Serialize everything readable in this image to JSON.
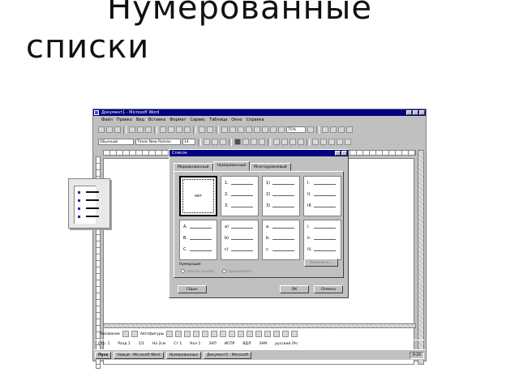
{
  "slide": {
    "title_line1": "Нумерованные",
    "title_line2": "списки"
  },
  "window": {
    "title": "Документ1 - Microsoft Word",
    "menu": [
      "Файл",
      "Правка",
      "Вид",
      "Вставка",
      "Формат",
      "Сервис",
      "Таблица",
      "Окно",
      "Справка"
    ],
    "style_combo": "Обычный",
    "font_combo": "Times New Roman",
    "size_combo": "14",
    "zoom_combo": "75%",
    "draw_label": "Рисование",
    "autoshapes_label": "Автофигуры",
    "status": [
      "Стр. 1",
      "Разд 1",
      "1/1",
      "На 2см",
      "Ст 1",
      "Кол 1",
      "ЗАП",
      "ИСПР",
      "ВДЛ",
      "ЗАМ",
      "русский (Ро"
    ],
    "taskbar": {
      "start": "Пуск",
      "items": [
        "Новый - Microsoft Word",
        "Нумерованные",
        "Документ1 - Microsoft"
      ],
      "clock": "9:26"
    }
  },
  "dialog": {
    "title": "Список",
    "tabs": [
      "Маркированный",
      "Нумерованный",
      "Многоуровневый"
    ],
    "active_tab": 1,
    "none_label": "нет",
    "numbering_styles": [
      [
        "1.",
        "2.",
        "3."
      ],
      [
        "1)",
        "2)",
        "3)"
      ],
      [
        "I.",
        "II.",
        "III."
      ],
      [
        "A.",
        "B.",
        "C."
      ],
      [
        "a)",
        "b)",
        "c)"
      ],
      [
        "a.",
        "b.",
        "c."
      ],
      [
        "i.",
        "ii.",
        "iii."
      ]
    ],
    "group_label": "Нумерация",
    "radio_restart": "начать заново",
    "radio_continue": "продолжить",
    "change_button": "Изменить...",
    "reset_button": "Сброс",
    "ok_button": "ОК",
    "cancel_button": "Отмена"
  }
}
